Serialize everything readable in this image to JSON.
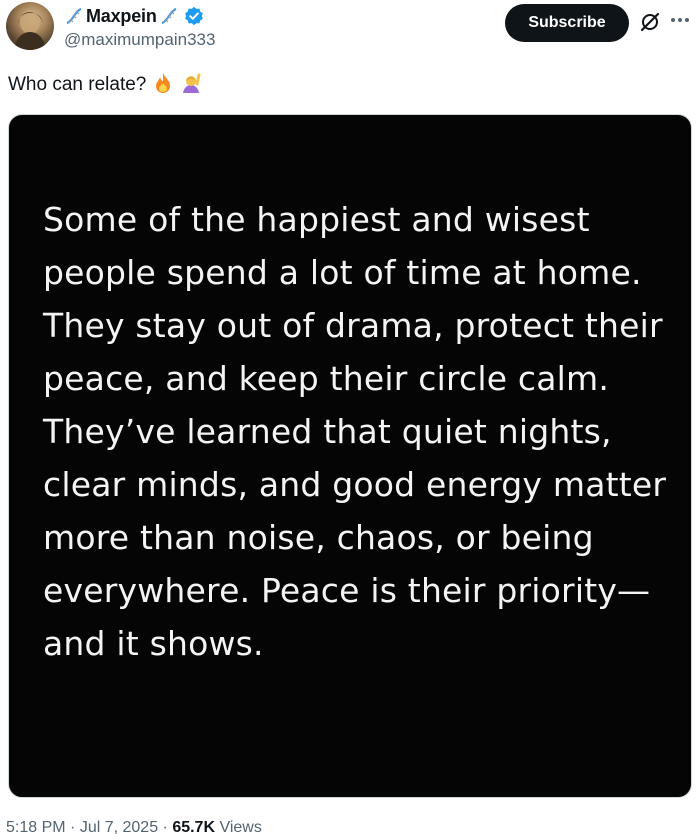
{
  "author": {
    "name_prefix_icon": "dna-emoji",
    "display_name": "Maxpein",
    "name_suffix_icon": "dna-emoji",
    "handle": "@maximumpain333",
    "verified": true
  },
  "header": {
    "subscribe_label": "Subscribe",
    "grok_icon": "grok-icon",
    "more_icon": "more-icon"
  },
  "post": {
    "text": "Who can relate?",
    "emojis": [
      "🔥",
      "🙋‍♀️"
    ],
    "image_text": "Some of the happiest and wisest people spend a lot of time at home. They stay out of drama, protect their peace, and keep their circle calm. They’ve learned that quiet nights, clear minds, and good energy matter more than noise, chaos, or being everywhere. Peace is their priority—and it shows."
  },
  "meta": {
    "time": "5:18 PM",
    "separator": " · ",
    "date": "Jul 7, 2025",
    "views_count": "65.7K",
    "views_label": " Views"
  },
  "colors": {
    "primary_text": "#0f1419",
    "secondary_text": "#536471",
    "verified_blue": "#1d9bf0",
    "button_bg": "#0f1419",
    "image_bg": "#050505"
  }
}
